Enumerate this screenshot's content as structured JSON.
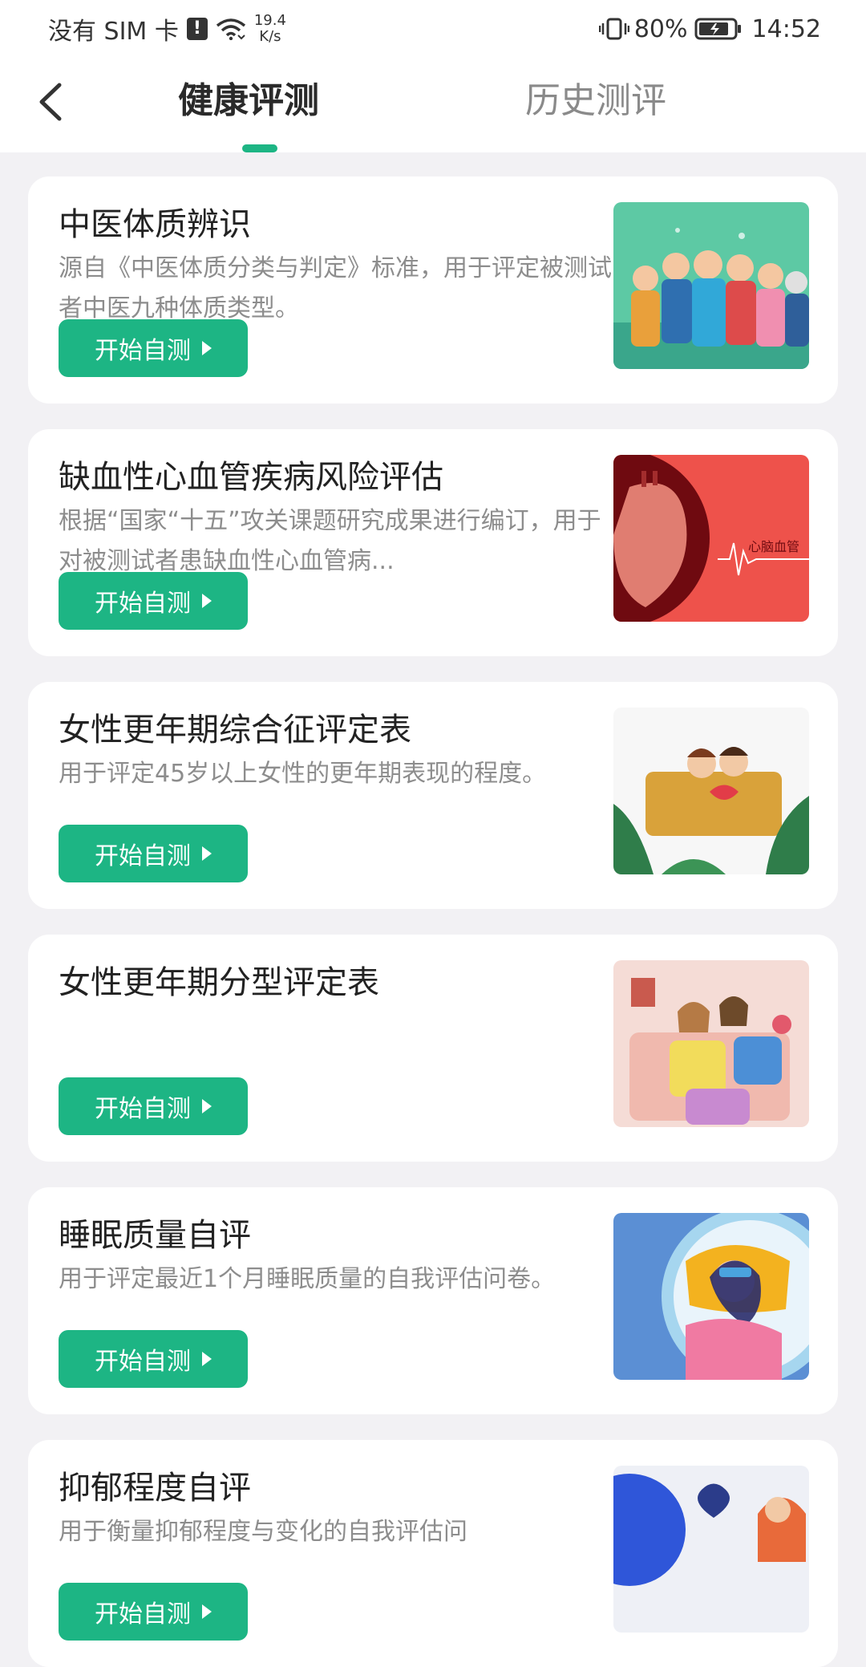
{
  "status_bar": {
    "carrier": "没有 SIM 卡",
    "speed_value": "19.4",
    "speed_unit": "K/s",
    "battery": "80%",
    "time": "14:52"
  },
  "header": {
    "tabs": [
      {
        "label": "健康评测",
        "active": true
      },
      {
        "label": "历史测评",
        "active": false
      }
    ],
    "accent_color": "#1db584"
  },
  "cards": [
    {
      "title": "中医体质辨识",
      "description": "源自《中医体质分类与判定》标准，用于评定被测试者中医九种体质类型。",
      "button_label": "开始自测",
      "image": "group-of-people-illustration"
    },
    {
      "title": "缺血性心血管疾病风险评估",
      "description": "根据“国家“十五”攻关课题研究成果进行编订，用于对被测试者患缺血性心血管病...",
      "button_label": "开始自测",
      "image": "heart-illustration",
      "image_text": "心脑血管"
    },
    {
      "title": "女性更年期综合征评定表",
      "description": "用于评定45岁以上女性的更年期表现的程度。",
      "button_label": "开始自测",
      "image": "women-on-sofa-illustration"
    },
    {
      "title": "女性更年期分型评定表",
      "description": "",
      "button_label": "开始自测",
      "image": "women-knitting-illustration"
    },
    {
      "title": "睡眠质量自评",
      "description": "用于评定最近1个月睡眠质量的自我评估问卷。",
      "button_label": "开始自测",
      "image": "sleeping-woman-illustration"
    },
    {
      "title": "抑郁程度自评",
      "description": "用于衡量抑郁程度与变化的自我评估问",
      "button_label": "开始自测",
      "image": "broken-heart-illustration"
    }
  ]
}
